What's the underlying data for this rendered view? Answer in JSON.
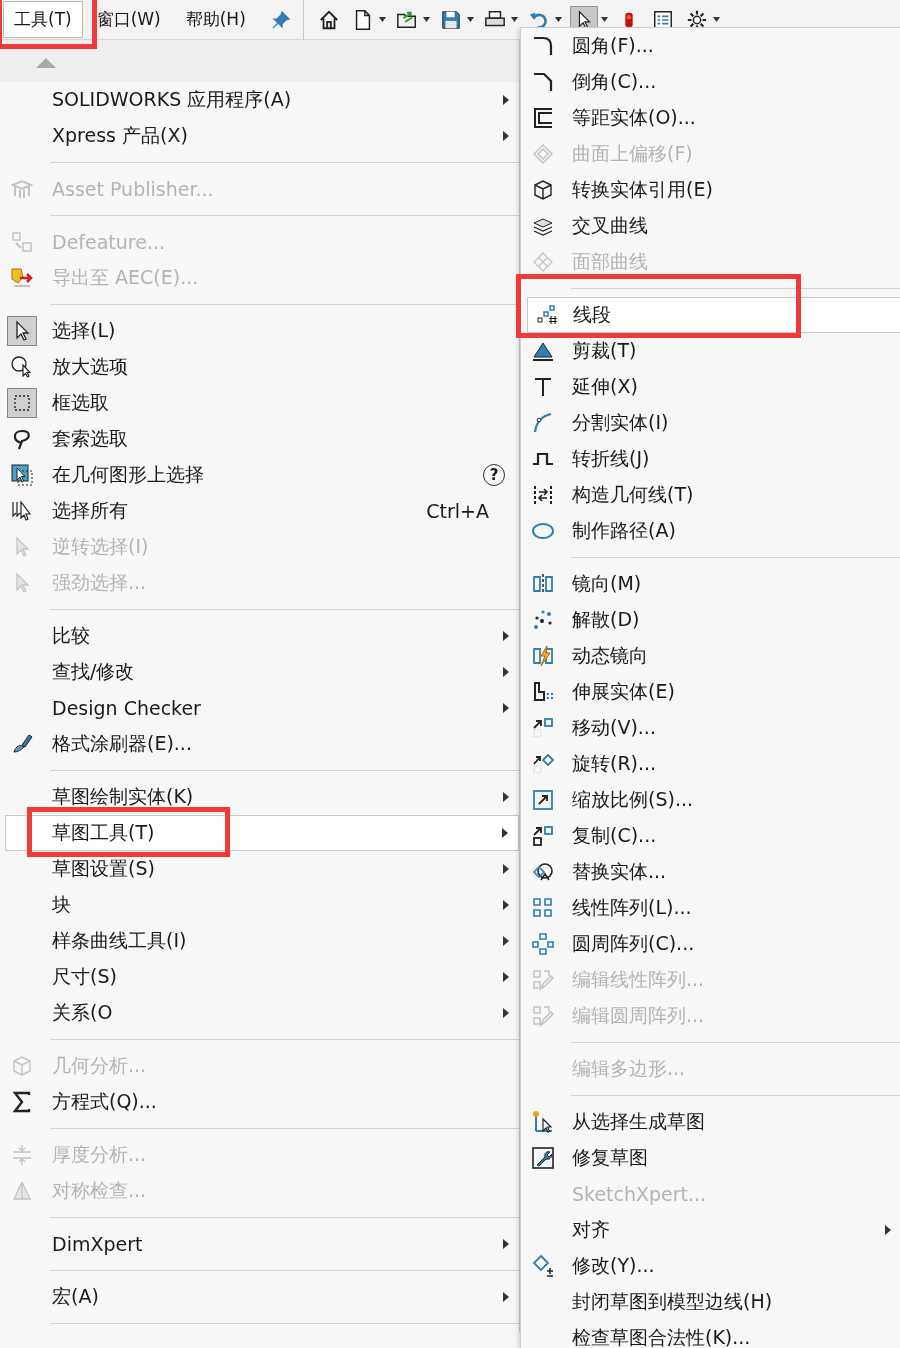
{
  "menu_bar": [
    {
      "label": "工具(T)",
      "selected": true,
      "annotated": true
    },
    {
      "label": "窗口(W)",
      "selected": false,
      "annotated": false
    },
    {
      "label": "帮助(H)",
      "selected": false,
      "annotated": false
    }
  ],
  "toolbar": [
    {
      "selected": false,
      "dropdown": false
    },
    {
      "selected": false,
      "dropdown": true
    },
    {
      "selected": false,
      "dropdown": true
    },
    {
      "selected": false,
      "dropdown": true
    },
    {
      "selected": false,
      "dropdown": true
    },
    {
      "selected": false,
      "dropdown": true
    },
    {
      "selected": true,
      "dropdown": true
    },
    {
      "selected": false,
      "dropdown": false
    },
    {
      "selected": false,
      "dropdown": false
    },
    {
      "selected": false,
      "dropdown": true
    }
  ],
  "tools_menu": [
    {
      "kind": "item",
      "label": "SOLIDWORKS 应用程序(A)",
      "disabled": false,
      "submenu": true,
      "selected": false,
      "annotated": false
    },
    {
      "kind": "item",
      "label": "Xpress 产品(X)",
      "disabled": false,
      "submenu": true,
      "selected": false,
      "annotated": false
    },
    {
      "kind": "separator"
    },
    {
      "kind": "item",
      "label": "Asset Publisher...",
      "disabled": true,
      "submenu": false,
      "selected": false,
      "annotated": false
    },
    {
      "kind": "separator"
    },
    {
      "kind": "item",
      "label": "Defeature...",
      "disabled": true,
      "submenu": false,
      "selected": false,
      "annotated": false
    },
    {
      "kind": "item",
      "label": "导出至 AEC(E)...",
      "disabled": true,
      "submenu": false,
      "selected": false,
      "annotated": false
    },
    {
      "kind": "separator"
    },
    {
      "kind": "item",
      "label": "选择(L)",
      "disabled": false,
      "submenu": false,
      "selected": false,
      "annotated": false
    },
    {
      "kind": "item",
      "label": "放大选项",
      "disabled": false,
      "submenu": false,
      "selected": false,
      "annotated": false
    },
    {
      "kind": "item",
      "label": "框选取",
      "disabled": false,
      "submenu": false,
      "selected": false,
      "annotated": false
    },
    {
      "kind": "item",
      "label": "套索选取",
      "disabled": false,
      "submenu": false,
      "selected": false,
      "annotated": false
    },
    {
      "kind": "item",
      "label": "在几何图形上选择",
      "disabled": false,
      "submenu": false,
      "selected": false,
      "annotated": false,
      "badge": "?"
    },
    {
      "kind": "item",
      "label": "选择所有",
      "disabled": false,
      "submenu": false,
      "selected": false,
      "annotated": false,
      "shortcut": "Ctrl+A"
    },
    {
      "kind": "item",
      "label": "逆转选择(I)",
      "disabled": true,
      "submenu": false,
      "selected": false,
      "annotated": false
    },
    {
      "kind": "item",
      "label": "强劲选择...",
      "disabled": true,
      "submenu": false,
      "selected": false,
      "annotated": false
    },
    {
      "kind": "separator"
    },
    {
      "kind": "item",
      "label": "比较",
      "disabled": false,
      "submenu": true,
      "selected": false,
      "annotated": false
    },
    {
      "kind": "item",
      "label": "查找/修改",
      "disabled": false,
      "submenu": true,
      "selected": false,
      "annotated": false
    },
    {
      "kind": "item",
      "label": "Design Checker",
      "disabled": false,
      "submenu": true,
      "selected": false,
      "annotated": false
    },
    {
      "kind": "item",
      "label": "格式涂刷器(E)...",
      "disabled": false,
      "submenu": false,
      "selected": false,
      "annotated": false
    },
    {
      "kind": "separator"
    },
    {
      "kind": "item",
      "label": "草图绘制实体(K)",
      "disabled": false,
      "submenu": true,
      "selected": false,
      "annotated": false
    },
    {
      "kind": "item",
      "label": "草图工具(T)",
      "disabled": false,
      "submenu": true,
      "selected": true,
      "annotated": true
    },
    {
      "kind": "item",
      "label": "草图设置(S)",
      "disabled": false,
      "submenu": true,
      "selected": false,
      "annotated": false
    },
    {
      "kind": "item",
      "label": "块",
      "disabled": false,
      "submenu": true,
      "selected": false,
      "annotated": false
    },
    {
      "kind": "item",
      "label": "样条曲线工具(I)",
      "disabled": false,
      "submenu": true,
      "selected": false,
      "annotated": false
    },
    {
      "kind": "item",
      "label": "尺寸(S)",
      "disabled": false,
      "submenu": true,
      "selected": false,
      "annotated": false
    },
    {
      "kind": "item",
      "label": "关系(O",
      "disabled": false,
      "submenu": true,
      "selected": false,
      "annotated": false
    },
    {
      "kind": "separator"
    },
    {
      "kind": "item",
      "label": "几何分析...",
      "disabled": true,
      "submenu": false,
      "selected": false,
      "annotated": false
    },
    {
      "kind": "item",
      "label": "方程式(Q)...",
      "disabled": false,
      "submenu": false,
      "selected": false,
      "annotated": false
    },
    {
      "kind": "separator"
    },
    {
      "kind": "item",
      "label": "厚度分析...",
      "disabled": true,
      "submenu": false,
      "selected": false,
      "annotated": false
    },
    {
      "kind": "item",
      "label": "对称检查...",
      "disabled": true,
      "submenu": false,
      "selected": false,
      "annotated": false
    },
    {
      "kind": "separator"
    },
    {
      "kind": "item",
      "label": "DimXpert",
      "disabled": false,
      "submenu": true,
      "selected": false,
      "annotated": false
    },
    {
      "kind": "separator"
    },
    {
      "kind": "item",
      "label": "宏(A)",
      "disabled": false,
      "submenu": true,
      "selected": false,
      "annotated": false
    },
    {
      "kind": "separator"
    }
  ],
  "sketch_tools_submenu": [
    {
      "kind": "item",
      "label": "圆角(F)...",
      "disabled": false,
      "submenu": false,
      "selected": false,
      "annotated": false
    },
    {
      "kind": "item",
      "label": "倒角(C)...",
      "disabled": false,
      "submenu": false,
      "selected": false,
      "annotated": false
    },
    {
      "kind": "item",
      "label": "等距实体(O)...",
      "disabled": false,
      "submenu": false,
      "selected": false,
      "annotated": false
    },
    {
      "kind": "item",
      "label": "曲面上偏移(F)",
      "disabled": true,
      "submenu": false,
      "selected": false,
      "annotated": false
    },
    {
      "kind": "item",
      "label": "转换实体引用(E)",
      "disabled": false,
      "submenu": false,
      "selected": false,
      "annotated": false
    },
    {
      "kind": "item",
      "label": "交叉曲线",
      "disabled": false,
      "submenu": false,
      "selected": false,
      "annotated": false
    },
    {
      "kind": "item",
      "label": "面部曲线",
      "disabled": true,
      "submenu": false,
      "selected": false,
      "annotated": false
    },
    {
      "kind": "separator"
    },
    {
      "kind": "item",
      "label": "线段",
      "disabled": false,
      "submenu": false,
      "selected": true,
      "annotated": true
    },
    {
      "kind": "item",
      "label": "剪裁(T)",
      "disabled": false,
      "submenu": false,
      "selected": false,
      "annotated": false
    },
    {
      "kind": "item",
      "label": "延伸(X)",
      "disabled": false,
      "submenu": false,
      "selected": false,
      "annotated": false
    },
    {
      "kind": "item",
      "label": "分割实体(I)",
      "disabled": false,
      "submenu": false,
      "selected": false,
      "annotated": false
    },
    {
      "kind": "item",
      "label": "转折线(J)",
      "disabled": false,
      "submenu": false,
      "selected": false,
      "annotated": false
    },
    {
      "kind": "item",
      "label": "构造几何线(T)",
      "disabled": false,
      "submenu": false,
      "selected": false,
      "annotated": false
    },
    {
      "kind": "item",
      "label": "制作路径(A)",
      "disabled": false,
      "submenu": false,
      "selected": false,
      "annotated": false
    },
    {
      "kind": "separator"
    },
    {
      "kind": "item",
      "label": "镜向(M)",
      "disabled": false,
      "submenu": false,
      "selected": false,
      "annotated": false
    },
    {
      "kind": "item",
      "label": "解散(D)",
      "disabled": false,
      "submenu": false,
      "selected": false,
      "annotated": false
    },
    {
      "kind": "item",
      "label": "动态镜向",
      "disabled": false,
      "submenu": false,
      "selected": false,
      "annotated": false
    },
    {
      "kind": "item",
      "label": "伸展实体(E)",
      "disabled": false,
      "submenu": false,
      "selected": false,
      "annotated": false
    },
    {
      "kind": "item",
      "label": "移动(V)...",
      "disabled": false,
      "submenu": false,
      "selected": false,
      "annotated": false
    },
    {
      "kind": "item",
      "label": "旋转(R)...",
      "disabled": false,
      "submenu": false,
      "selected": false,
      "annotated": false
    },
    {
      "kind": "item",
      "label": "缩放比例(S)...",
      "disabled": false,
      "submenu": false,
      "selected": false,
      "annotated": false
    },
    {
      "kind": "item",
      "label": "复制(C)...",
      "disabled": false,
      "submenu": false,
      "selected": false,
      "annotated": false
    },
    {
      "kind": "item",
      "label": "替换实体...",
      "disabled": false,
      "submenu": false,
      "selected": false,
      "annotated": false
    },
    {
      "kind": "item",
      "label": "线性阵列(L)...",
      "disabled": false,
      "submenu": false,
      "selected": false,
      "annotated": false
    },
    {
      "kind": "item",
      "label": "圆周阵列(C)...",
      "disabled": false,
      "submenu": false,
      "selected": false,
      "annotated": false
    },
    {
      "kind": "item",
      "label": "编辑线性阵列...",
      "disabled": true,
      "submenu": false,
      "selected": false,
      "annotated": false
    },
    {
      "kind": "item",
      "label": "编辑圆周阵列...",
      "disabled": true,
      "submenu": false,
      "selected": false,
      "annotated": false
    },
    {
      "kind": "separator"
    },
    {
      "kind": "item",
      "label": "编辑多边形...",
      "disabled": true,
      "submenu": false,
      "selected": false,
      "annotated": false
    },
    {
      "kind": "separator"
    },
    {
      "kind": "item",
      "label": "从选择生成草图",
      "disabled": false,
      "submenu": false,
      "selected": false,
      "annotated": false
    },
    {
      "kind": "item",
      "label": "修复草图",
      "disabled": false,
      "submenu": false,
      "selected": false,
      "annotated": false
    },
    {
      "kind": "item",
      "label": "SketchXpert...",
      "disabled": true,
      "submenu": false,
      "selected": false,
      "annotated": false
    },
    {
      "kind": "item",
      "label": "对齐",
      "disabled": false,
      "submenu": true,
      "selected": false,
      "annotated": false
    },
    {
      "kind": "item",
      "label": "修改(Y)...",
      "disabled": false,
      "submenu": false,
      "selected": false,
      "annotated": false
    },
    {
      "kind": "item",
      "label": "封闭草图到模型边线(H)",
      "disabled": false,
      "submenu": false,
      "selected": false,
      "annotated": false
    },
    {
      "kind": "item",
      "label": "检查草图合法性(K)...",
      "disabled": false,
      "submenu": false,
      "selected": false,
      "annotated": false
    }
  ]
}
